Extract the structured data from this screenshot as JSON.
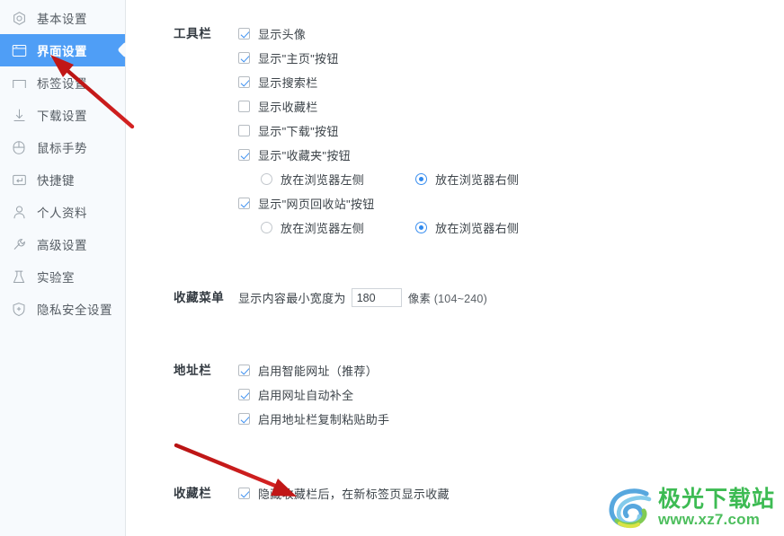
{
  "theme": {
    "accent_blue": "#4f9ef6",
    "check_blue": "#3b8ff0",
    "sidebar_bg": "#f7fafd",
    "content_bg": "#ffffff",
    "arrow_red": "#c71a1a"
  },
  "sidebar": {
    "items": [
      {
        "label": "基本设置",
        "icon": "hexagon-gear-icon",
        "active": false
      },
      {
        "label": "界面设置",
        "icon": "browser-window-icon",
        "active": true
      },
      {
        "label": "标签设置",
        "icon": "tab-icon",
        "active": false
      },
      {
        "label": "下载设置",
        "icon": "download-arrow-icon",
        "active": false
      },
      {
        "label": "鼠标手势",
        "icon": "mouse-icon",
        "active": false
      },
      {
        "label": "快捷键",
        "icon": "keyboard-key-icon",
        "active": false
      },
      {
        "label": "个人资料",
        "icon": "person-icon",
        "active": false
      },
      {
        "label": "高级设置",
        "icon": "wrench-icon",
        "active": false
      },
      {
        "label": "实验室",
        "icon": "flask-icon",
        "active": false
      },
      {
        "label": "隐私安全设置",
        "icon": "shield-plus-icon",
        "active": false
      }
    ]
  },
  "sections": {
    "toolbar": {
      "label": "工具栏",
      "checkboxes": [
        {
          "label": "显示头像",
          "checked": true
        },
        {
          "label": "显示\"主页\"按钮",
          "checked": true
        },
        {
          "label": "显示搜索栏",
          "checked": true
        },
        {
          "label": "显示收藏栏",
          "checked": false
        },
        {
          "label": "显示\"下载\"按钮",
          "checked": false
        }
      ],
      "favorites_button": {
        "label": "显示\"收藏夹\"按钮",
        "checked": true,
        "radios": [
          {
            "label": "放在浏览器左侧",
            "selected": false
          },
          {
            "label": "放在浏览器右侧",
            "selected": true
          }
        ]
      },
      "recycle_button": {
        "label": "显示\"网页回收站\"按钮",
        "checked": true,
        "radios": [
          {
            "label": "放在浏览器左侧",
            "selected": false
          },
          {
            "label": "放在浏览器右侧",
            "selected": true
          }
        ]
      }
    },
    "favorites_menu": {
      "label": "收藏菜单",
      "prefix": "显示内容最小宽度为",
      "value": "180",
      "placeholder": "180",
      "suffix_unit": "像素",
      "suffix_range": "(104~240)"
    },
    "address_bar": {
      "label": "地址栏",
      "checkboxes": [
        {
          "label": "启用智能网址（推荐）",
          "checked": true
        },
        {
          "label": "启用网址自动补全",
          "checked": true
        },
        {
          "label": "启用地址栏复制粘贴助手",
          "checked": true
        }
      ]
    },
    "favorites_bar": {
      "label": "收藏栏",
      "checkboxes": [
        {
          "label": "隐藏收藏栏后，在新标签页显示收藏",
          "checked": true
        }
      ]
    }
  },
  "annotations": {
    "arrow_to_sidebar_interface_settings": "red-arrow-icon",
    "arrow_to_favorites_bar_checkbox": "red-arrow-icon"
  },
  "watermark": {
    "title": "极光下载站",
    "url": "www.xz7.com",
    "logo": "aurora-swirl-logo-icon"
  }
}
